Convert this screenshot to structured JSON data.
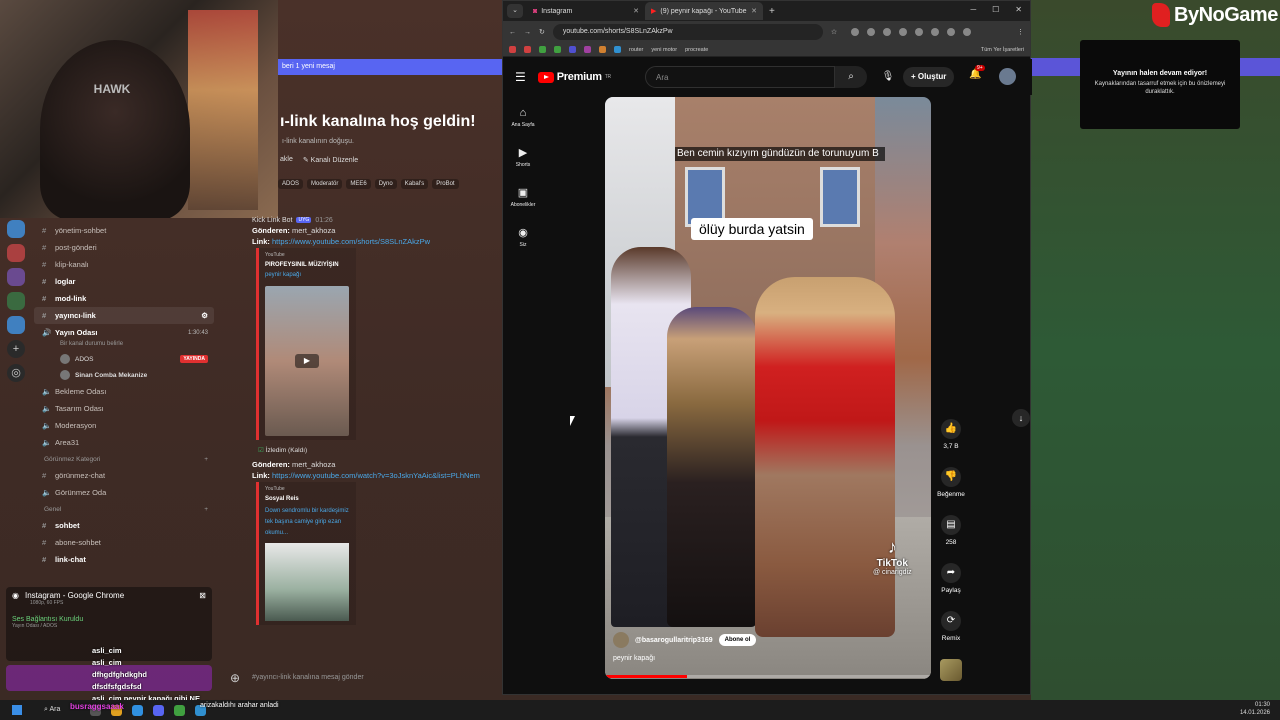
{
  "discord": {
    "new_message_bar": "beri 1 yeni mesaj",
    "welcome_title": "ı-link kanalına hoş geldin!",
    "welcome_sub": "ı-link kanalının doğuşu.",
    "action_1": "akle",
    "action_2": "Kanalı Düzenle",
    "roles": [
      "ADOS",
      "Moderatör",
      "MEE6",
      "Dyno",
      "Kabal's",
      "ProBot"
    ],
    "channels": [
      {
        "name": "yönetim-sohbet",
        "bold": false
      },
      {
        "name": "post-gönderi",
        "bold": false
      },
      {
        "name": "klip-kanalı",
        "bold": false
      },
      {
        "name": "loglar",
        "bold": true
      },
      {
        "name": "mod-link",
        "bold": true
      },
      {
        "name": "yayıncı-link",
        "bold": true
      }
    ],
    "voice_channel": "Yayın Odası",
    "voice_time": "1:30:43",
    "voice_desc": "Bir kanal durumu belirle",
    "voice_users": [
      {
        "name": "ADOS",
        "live": "YAYINDA"
      },
      {
        "name": "Sinan Comba Mekanize",
        "live": ""
      }
    ],
    "voice_rooms": [
      "Bekleme Odası",
      "Tasarım Odası",
      "Moderasyon",
      "Area31"
    ],
    "hidden_category": "Görünmez Kategori",
    "hidden_channels": [
      "görünmez-chat",
      "Görünmez Oda"
    ],
    "general_category": "Genel",
    "general_channels": [
      "sohbet",
      "abone-sohbet",
      "link-chat"
    ],
    "stream_panel_title": "Instagram - Google Chrome",
    "stream_panel_sub": "1080p, 60 FPS",
    "voice_connected": "Ses Bağlantısı Kuruldu",
    "voice_connected_sub": "Yayın Odası / ADOS",
    "overlay_chat": [
      "asli_cim",
      "asli_cim",
      "dfhgdfghdkghd",
      "dfsdfsfgdsfsd",
      "asli_cim peynir kapağı gibi NE"
    ],
    "bot_name": "Kick Link Bot",
    "bot_tag": "UYG",
    "bot_time": "01:26",
    "msg1_sender_label": "Gönderen:",
    "msg1_sender": "mert_akhoza",
    "msg1_link_label": "Link:",
    "msg1_link": "https://www.youtube.com/shorts/S8SLnZAkzPw",
    "embed1_source": "YouTube",
    "embed1_author": "PIROFEYSINIL MÜZIYİŞIN",
    "embed1_title": "peynir kapağı",
    "seen_label": "İzledim (Kaldı)",
    "msg2_sender": "mert_akhoza",
    "msg2_link": "https://www.youtube.com/watch?v=3oJsknYaAic&list=PLhNem",
    "embed2_source": "YouTube",
    "embed2_author": "Sosyal Reis",
    "embed2_title": "Down sendromlu bir kardeşimiz tek başına camiye girip ezan okumu...",
    "input_placeholder": "#yayıncı-link kanalına mesaj gönder"
  },
  "chrome": {
    "tabs": [
      {
        "label": "Instagram",
        "active": false
      },
      {
        "label": "(9) peynir kapağı - YouTube",
        "active": true
      }
    ],
    "url": "youtube.com/shorts/S8SLnZAkzPw",
    "bookmarks": [
      "router",
      "yeni motor",
      "procreate",
      "Tüm Yer İşaretleri"
    ]
  },
  "youtube": {
    "logo": "Premium",
    "logo_sup": "TR",
    "search_placeholder": "Ara",
    "create_label": "Oluştur",
    "notif_count": "9+",
    "sidebar": [
      {
        "icon": "home-icon",
        "label": "Ana Sayfa"
      },
      {
        "icon": "shorts-icon",
        "label": "Shorts"
      },
      {
        "icon": "subscriptions-icon",
        "label": "Abonelikler"
      },
      {
        "icon": "you-icon",
        "label": "Siz"
      }
    ],
    "caption_top": "Ben cemin kızıyım gündüzün de torunuyum B",
    "caption_mid": "ölüy burda yatsin",
    "tiktok_label": "TikTok",
    "tiktok_handle": "@ cinarigdiz",
    "channel": "@basarogullaritrip3169",
    "subscribe": "Abone ol",
    "short_title": "peynir kapağı",
    "progress": 0.25,
    "likes": "3,7 B",
    "dislike_label": "Beğenme",
    "comments": "258",
    "share_label": "Paylaş",
    "remix_label": "Remix"
  },
  "overlay": {
    "brand": "ByNoGame",
    "notice_title": "Yayının halen devam ediyor!",
    "notice_body": "Kaynaklarından tasarruf etmek için bu önizlemeyi duraklattık."
  },
  "taskbar": {
    "search": "Ara",
    "overlay_name": "busraggsaaak",
    "overlay_msg": "arizakaldıhı arahar anladi",
    "time": "01:30",
    "date": "14.01.2026"
  },
  "webcam": {
    "cap_text": "HAWK"
  }
}
